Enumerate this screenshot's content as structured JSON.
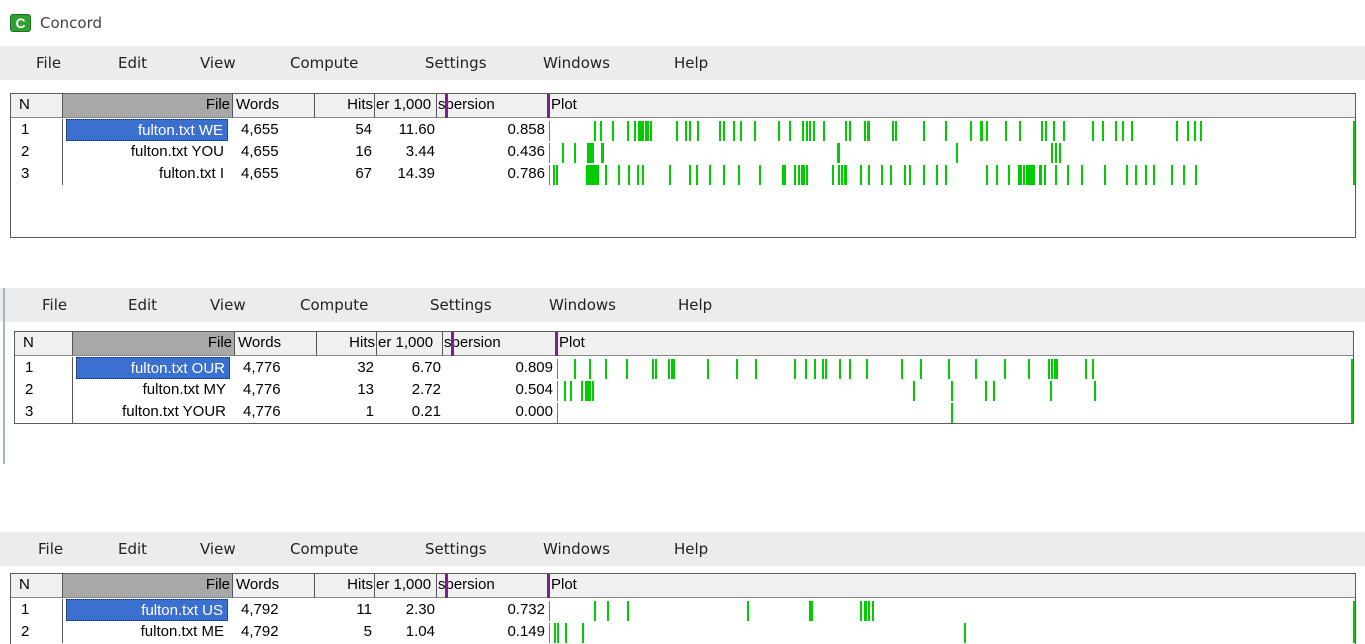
{
  "window": {
    "title": "Concord",
    "icon": "concord-app-icon",
    "icon_letter": "C"
  },
  "menu": [
    "File",
    "Edit",
    "View",
    "Compute",
    "Settings",
    "Windows",
    "Help"
  ],
  "columns": {
    "n": "N",
    "file": "File",
    "words": "Words",
    "hits": "Hits",
    "per_1000": "er 1,000",
    "dispersion": "spersion",
    "plot": "Plot"
  },
  "panels": [
    {
      "rows": [
        {
          "n": "1",
          "file": "fulton.txt WE",
          "words": "4,655",
          "hits": "54",
          "per_1000": "11.60",
          "dispersion": "0.858",
          "selected": true,
          "hit_positions": [
            0.055,
            0.063,
            0.078,
            0.097,
            0.105,
            0.11,
            0.113,
            0.116,
            0.119,
            0.122,
            0.125,
            0.158,
            0.169,
            0.174,
            0.185,
            0.212,
            0.217,
            0.23,
            0.239,
            0.256,
            0.287,
            0.3,
            0.316,
            0.321,
            0.326,
            0.33,
            0.343,
            0.37,
            0.375,
            0.394,
            0.398,
            0.399,
            0.43,
            0.434,
            0.468,
            0.496,
            0.528,
            0.54,
            0.541,
            0.548,
            0.571,
            0.589,
            0.617,
            0.622,
            0.632,
            0.644,
            0.681,
            0.694,
            0.71,
            0.719,
            0.73,
            0.787,
            0.8,
            0.809,
            0.817
          ]
        },
        {
          "n": "2",
          "file": "fulton.txt YOU",
          "words": "4,655",
          "hits": "16",
          "per_1000": "3.44",
          "dispersion": "0.436",
          "selected": false,
          "hit_positions": [
            0.015,
            0.03,
            0.046,
            0.049,
            0.05,
            0.053,
            0.064,
            0.065,
            0.36,
            0.36,
            0.361,
            0.362,
            0.51,
            0.63,
            0.635,
            0.64
          ]
        },
        {
          "n": "3",
          "file": "fulton.txt I",
          "words": "4,655",
          "hits": "67",
          "per_1000": "14.39",
          "dispersion": "0.786",
          "selected": false,
          "hit_positions": [
            0.004,
            0.008,
            0.045,
            0.048,
            0.05,
            0.052,
            0.054,
            0.057,
            0.059,
            0.069,
            0.085,
            0.098,
            0.109,
            0.116,
            0.149,
            0.175,
            0.184,
            0.2,
            0.217,
            0.236,
            0.263,
            0.291,
            0.294,
            0.307,
            0.312,
            0.315,
            0.318,
            0.321,
            0.354,
            0.362,
            0.365,
            0.369,
            0.37,
            0.389,
            0.4,
            0.416,
            0.427,
            0.445,
            0.451,
            0.468,
            0.485,
            0.496,
            0.548,
            0.56,
            0.575,
            0.588,
            0.591,
            0.594,
            0.598,
            0.6,
            0.603,
            0.605,
            0.607,
            0.614,
            0.615,
            0.62,
            0.634,
            0.649,
            0.667,
            0.696,
            0.724,
            0.735,
            0.748,
            0.757,
            0.78,
            0.795,
            0.81
          ]
        }
      ]
    },
    {
      "rows": [
        {
          "n": "1",
          "file": "fulton.txt OUR",
          "words": "4,776",
          "hits": "32",
          "per_1000": "6.70",
          "dispersion": "0.809",
          "selected": true,
          "hit_positions": [
            0.02,
            0.04,
            0.06,
            0.086,
            0.12,
            0.123,
            0.14,
            0.144,
            0.146,
            0.19,
            0.226,
            0.25,
            0.3,
            0.314,
            0.326,
            0.336,
            0.34,
            0.358,
            0.37,
            0.392,
            0.436,
            0.46,
            0.496,
            0.53,
            0.567,
            0.598,
            0.623,
            0.627,
            0.631,
            0.634,
            0.67,
            0.68
          ]
        },
        {
          "n": "2",
          "file": "fulton.txt MY",
          "words": "4,776",
          "hits": "13",
          "per_1000": "2.72",
          "dispersion": "0.504",
          "selected": false,
          "hit_positions": [
            0.007,
            0.015,
            0.029,
            0.034,
            0.037,
            0.04,
            0.043,
            0.452,
            0.5,
            0.543,
            0.553,
            0.626,
            0.682
          ]
        },
        {
          "n": "3",
          "file": "fulton.txt YOUR",
          "words": "4,776",
          "hits": "1",
          "per_1000": "0.21",
          "dispersion": "0.000",
          "selected": false,
          "hit_positions": [
            0.5
          ]
        }
      ]
    },
    {
      "rows": [
        {
          "n": "1",
          "file": "fulton.txt US",
          "words": "4,792",
          "hits": "11",
          "per_1000": "2.30",
          "dispersion": "0.732",
          "selected": true,
          "hit_positions": [
            0.055,
            0.071,
            0.097,
            0.247,
            0.325,
            0.328,
            0.39,
            0.394,
            0.396,
            0.4,
            0.404
          ]
        },
        {
          "n": "2",
          "file": "fulton.txt ME",
          "words": "4,792",
          "hits": "5",
          "per_1000": "1.04",
          "dispersion": "0.149",
          "selected": false,
          "hit_positions": [
            0.005,
            0.009,
            0.019,
            0.04,
            0.52
          ]
        }
      ]
    }
  ],
  "colors": {
    "hit_mark": "#00cc00",
    "selection": "#3b6fd0",
    "file_header": "#a8a8a8",
    "marker": "#7b1f8e"
  }
}
